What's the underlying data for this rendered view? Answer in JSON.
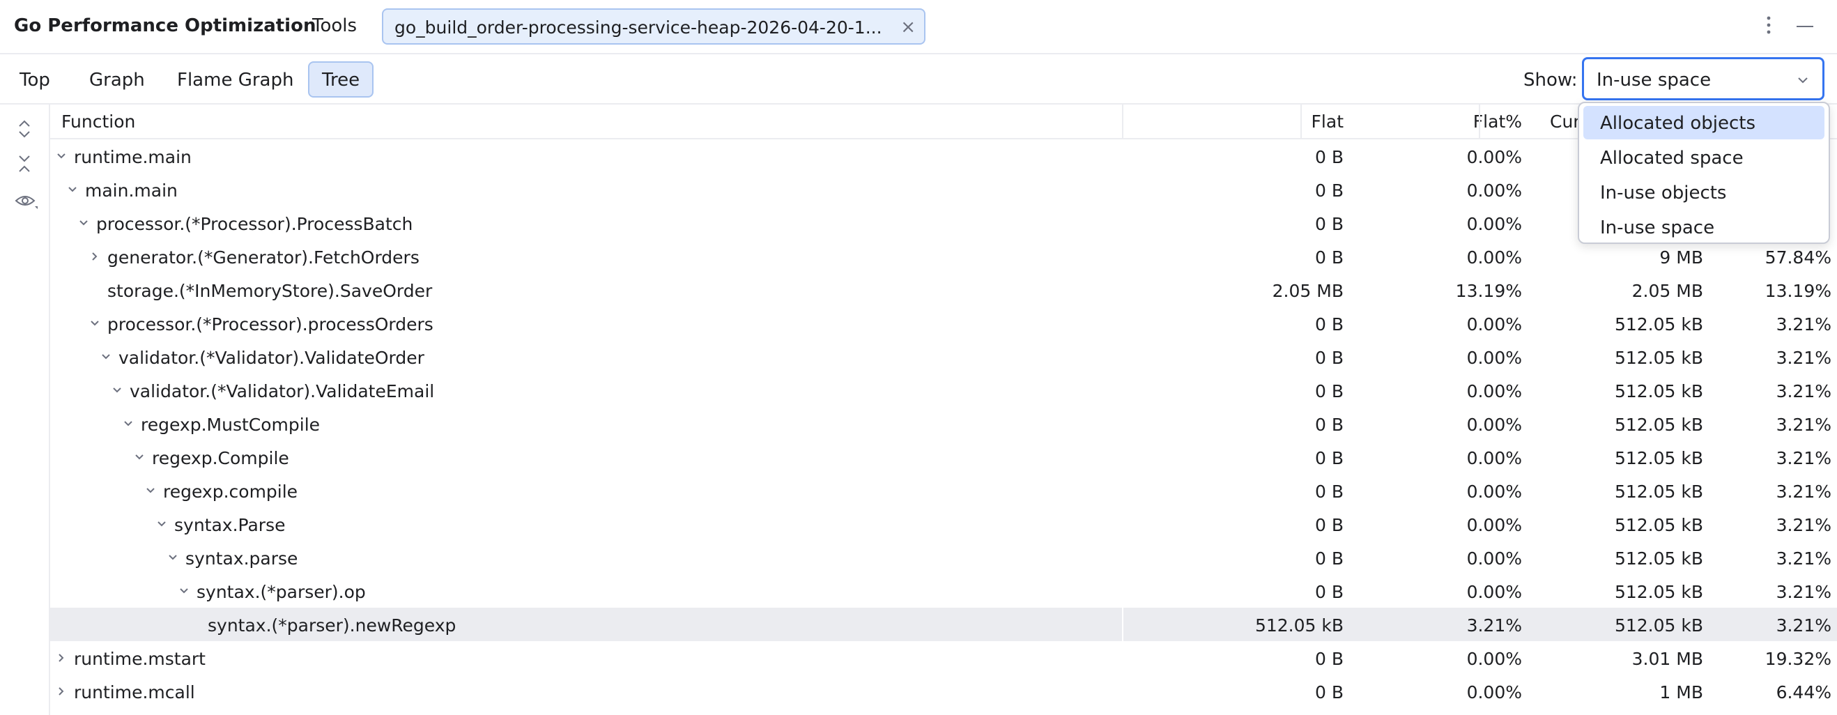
{
  "header": {
    "title": "Go Performance Optimization",
    "tools_label": "Tools",
    "file_tab_label": "go_build_order-processing-service-heap-2026-04-20-1...",
    "close_glyph": "×"
  },
  "toolbar": {
    "tabs": [
      {
        "label": "Top"
      },
      {
        "label": "Graph"
      },
      {
        "label": "Flame Graph"
      },
      {
        "label": "Tree"
      }
    ],
    "active_tab": "Tree",
    "show_label": "Show:",
    "show_value": "In-use space"
  },
  "dropdown": {
    "options": [
      {
        "label": "Allocated objects"
      },
      {
        "label": "Allocated space"
      },
      {
        "label": "In-use objects"
      },
      {
        "label": "In-use space"
      }
    ],
    "highlighted": "Allocated objects"
  },
  "table": {
    "columns": {
      "function": "Function",
      "flat": "Flat",
      "flat_pct": "Flat%",
      "cum": "Cum"
    },
    "rows": [
      {
        "name": "runtime.main",
        "depth": 0,
        "toggle": "expanded",
        "flat": "0 B",
        "flat_pct": "0.00%",
        "cum": "",
        "cum_pct": ""
      },
      {
        "name": "main.main",
        "depth": 1,
        "toggle": "expanded",
        "flat": "0 B",
        "flat_pct": "0.00%",
        "cum": "",
        "cum_pct": ""
      },
      {
        "name": "processor.(*Processor).ProcessBatch",
        "depth": 2,
        "toggle": "expanded",
        "flat": "0 B",
        "flat_pct": "0.00%",
        "cum": "",
        "cum_pct": ""
      },
      {
        "name": "generator.(*Generator).FetchOrders",
        "depth": 3,
        "toggle": "collapsed",
        "flat": "0 B",
        "flat_pct": "0.00%",
        "cum": "9 MB",
        "cum_pct": "57.84%"
      },
      {
        "name": "storage.(*InMemoryStore).SaveOrder",
        "depth": 3,
        "toggle": "none",
        "flat": "2.05 MB",
        "flat_pct": "13.19%",
        "cum": "2.05 MB",
        "cum_pct": "13.19%"
      },
      {
        "name": "processor.(*Processor).processOrders",
        "depth": 3,
        "toggle": "expanded",
        "flat": "0 B",
        "flat_pct": "0.00%",
        "cum": "512.05 kB",
        "cum_pct": "3.21%"
      },
      {
        "name": "validator.(*Validator).ValidateOrder",
        "depth": 4,
        "toggle": "expanded",
        "flat": "0 B",
        "flat_pct": "0.00%",
        "cum": "512.05 kB",
        "cum_pct": "3.21%"
      },
      {
        "name": "validator.(*Validator).ValidateEmail",
        "depth": 5,
        "toggle": "expanded",
        "flat": "0 B",
        "flat_pct": "0.00%",
        "cum": "512.05 kB",
        "cum_pct": "3.21%"
      },
      {
        "name": "regexp.MustCompile",
        "depth": 6,
        "toggle": "expanded",
        "flat": "0 B",
        "flat_pct": "0.00%",
        "cum": "512.05 kB",
        "cum_pct": "3.21%"
      },
      {
        "name": "regexp.Compile",
        "depth": 7,
        "toggle": "expanded",
        "flat": "0 B",
        "flat_pct": "0.00%",
        "cum": "512.05 kB",
        "cum_pct": "3.21%"
      },
      {
        "name": "regexp.compile",
        "depth": 8,
        "toggle": "expanded",
        "flat": "0 B",
        "flat_pct": "0.00%",
        "cum": "512.05 kB",
        "cum_pct": "3.21%"
      },
      {
        "name": "syntax.Parse",
        "depth": 9,
        "toggle": "expanded",
        "flat": "0 B",
        "flat_pct": "0.00%",
        "cum": "512.05 kB",
        "cum_pct": "3.21%"
      },
      {
        "name": "syntax.parse",
        "depth": 10,
        "toggle": "expanded",
        "flat": "0 B",
        "flat_pct": "0.00%",
        "cum": "512.05 kB",
        "cum_pct": "3.21%"
      },
      {
        "name": "syntax.(*parser).op",
        "depth": 11,
        "toggle": "expanded",
        "flat": "0 B",
        "flat_pct": "0.00%",
        "cum": "512.05 kB",
        "cum_pct": "3.21%"
      },
      {
        "name": "syntax.(*parser).newRegexp",
        "depth": 12,
        "toggle": "none",
        "flat": "512.05 kB",
        "flat_pct": "3.21%",
        "cum": "512.05 kB",
        "cum_pct": "3.21%",
        "selected": true
      },
      {
        "name": "runtime.mstart",
        "depth": 0,
        "toggle": "collapsed",
        "flat": "0 B",
        "flat_pct": "0.00%",
        "cum": "3.01 MB",
        "cum_pct": "19.32%"
      },
      {
        "name": "runtime.mcall",
        "depth": 0,
        "toggle": "collapsed",
        "flat": "0 B",
        "flat_pct": "0.00%",
        "cum": "1 MB",
        "cum_pct": "6.44%"
      }
    ]
  },
  "colors": {
    "accent": "#3574f0",
    "tab_bg": "#dfe9fb",
    "selected_row": "#ebecf0",
    "option_highlight": "#d4e2ff",
    "icon": "#6c707e"
  },
  "icons": {
    "more": "more-vertical-icon",
    "minimize": "minimize-icon",
    "expand_all": "expand-all-icon",
    "collapse_all": "collapse-all-icon",
    "view_options": "eye-icon",
    "chevron_down": "chevron-down-icon",
    "chevron_right": "chevron-right-icon",
    "close": "close-icon"
  }
}
